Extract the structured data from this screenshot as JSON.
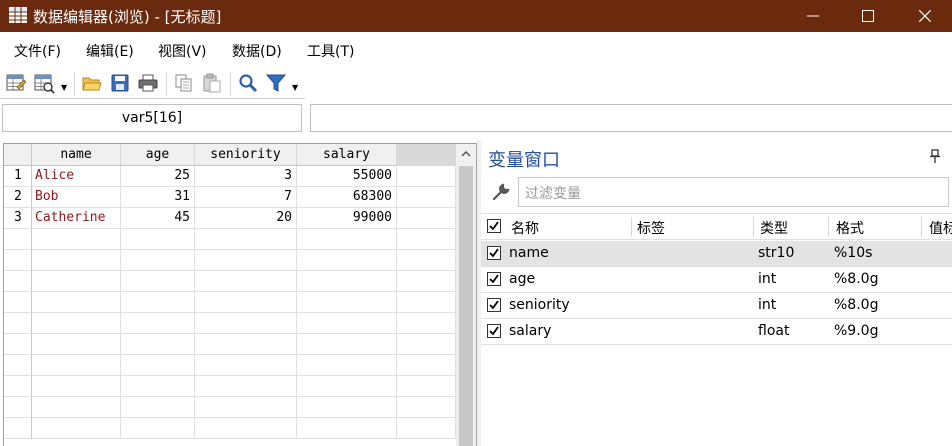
{
  "window": {
    "title": "数据编辑器(浏览) - [无标题]",
    "title_bar_color": "#6b2a0e"
  },
  "menu": {
    "items": [
      "文件(F)",
      "编辑(E)",
      "视图(V)",
      "数据(D)",
      "工具(T)"
    ]
  },
  "toolbar": {
    "icons": [
      "edit-mode-icon",
      "browse-mode-icon",
      "open-folder-icon",
      "save-icon",
      "print-icon",
      "copy-icon",
      "paste-icon",
      "search-icon",
      "filter-icon"
    ]
  },
  "cell_reference": {
    "name_box": "var5[16]",
    "value": ""
  },
  "data_grid": {
    "columns": [
      "name",
      "age",
      "seniority",
      "salary"
    ],
    "rows": [
      {
        "num": "1",
        "name": "Alice",
        "age": "25",
        "seniority": "3",
        "salary": "55000"
      },
      {
        "num": "2",
        "name": "Bob",
        "age": "31",
        "seniority": "7",
        "salary": "68300"
      },
      {
        "num": "3",
        "name": "Catherine",
        "age": "45",
        "seniority": "20",
        "salary": "99000"
      }
    ]
  },
  "variables_pane": {
    "title": "变量窗口",
    "filter_placeholder": "过滤变量",
    "headers": [
      "名称",
      "标签",
      "类型",
      "格式",
      "值标"
    ],
    "variables": [
      {
        "name": "name",
        "label": "",
        "type": "str10",
        "format": "%10s",
        "checked": true,
        "selected": true
      },
      {
        "name": "age",
        "label": "",
        "type": "int",
        "format": "%8.0g",
        "checked": true,
        "selected": false
      },
      {
        "name": "seniority",
        "label": "",
        "type": "int",
        "format": "%8.0g",
        "checked": true,
        "selected": false
      },
      {
        "name": "salary",
        "label": "",
        "type": "float",
        "format": "%9.0g",
        "checked": true,
        "selected": false
      }
    ]
  }
}
